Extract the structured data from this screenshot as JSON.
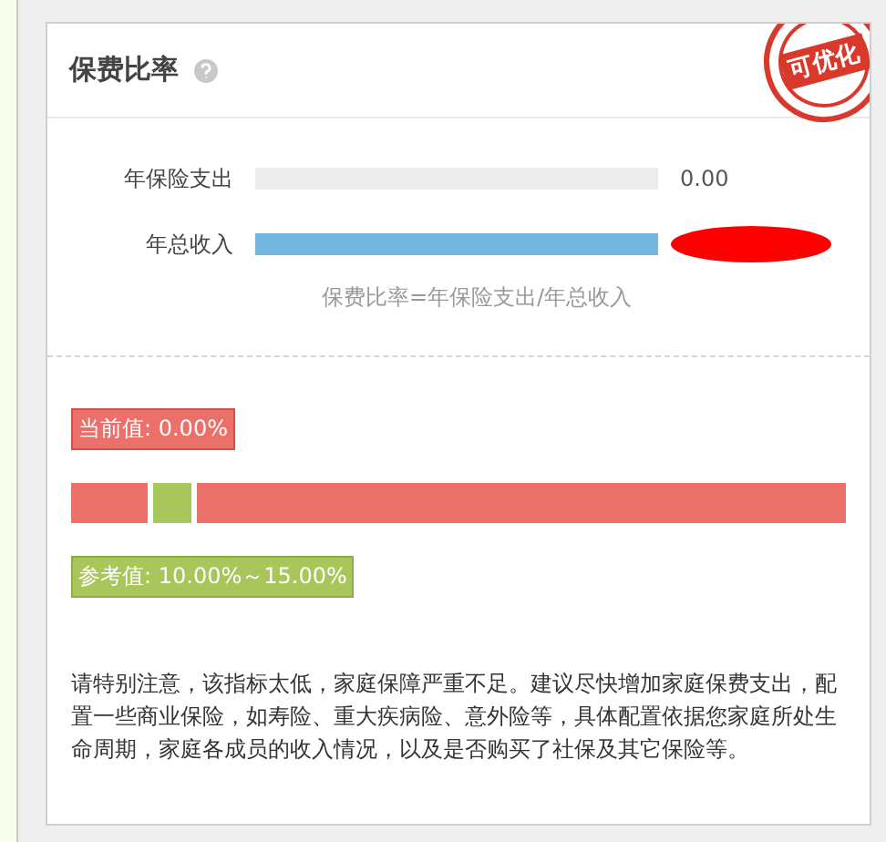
{
  "card": {
    "title": "保费比率",
    "stamp": "可优化"
  },
  "rows": [
    {
      "label": "年保险支出",
      "level": 0,
      "value": "0.00",
      "redacted": false
    },
    {
      "label": "年总收入",
      "level": 1,
      "redacted": true
    }
  ],
  "formula": "保费比率=年保险支出/年总收入",
  "scale": {
    "current": "当前值: 0.00%",
    "reference": "参考值: 10.00%～15.00%",
    "segments": [
      {
        "kind": "low"
      },
      {
        "kind": "target"
      },
      {
        "kind": "high"
      }
    ]
  },
  "advice": "请特别注意，该指标太低，家庭保障严重不足。建议尽快增加家庭保费支出，配置一些商业保险，如寿险、重大疾病险、意外险等，具体配置依据您家庭所处生命周期，家庭各成员的收入情况，以及是否购买了社保及其它保险等。"
}
